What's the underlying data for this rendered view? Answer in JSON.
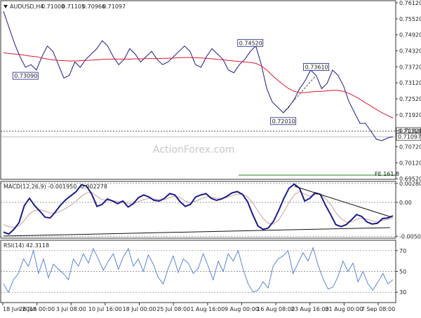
{
  "chart_data": [
    {
      "type": "line",
      "panel": "price",
      "symbol_label": "AUDUSD,H4",
      "ohlc": [
        "0.71000",
        "0.71105",
        "0.70966",
        "0.71097"
      ],
      "ylim": [
        0.695,
        0.762
      ],
      "yticks": [
        "0.76120",
        "0.75520",
        "0.74920",
        "0.74320",
        "0.73720",
        "0.73120",
        "0.72520",
        "0.71920",
        "0.71320",
        "0.70720",
        "0.70120",
        "0.69520"
      ],
      "series": [
        {
          "values": [
            0.758,
            0.752,
            0.746,
            0.741,
            0.737,
            0.738,
            0.736,
            0.741,
            0.745,
            0.743,
            0.738,
            0.733,
            0.734,
            0.739,
            0.737,
            0.74,
            0.742,
            0.744,
            0.747,
            0.745,
            0.741,
            0.738,
            0.74,
            0.744,
            0.742,
            0.739,
            0.741,
            0.743,
            0.74,
            0.738,
            0.739,
            0.741,
            0.743,
            0.745,
            0.743,
            0.738,
            0.737,
            0.741,
            0.744,
            0.742,
            0.74,
            0.736,
            0.735,
            0.738,
            0.74,
            0.743,
            0.745,
            0.738,
            0.729,
            0.724,
            0.722,
            0.72,
            0.722,
            0.725,
            0.729,
            0.732,
            0.736,
            0.734,
            0.729,
            0.731,
            0.736,
            0.734,
            0.73,
            0.724,
            0.72,
            0.716,
            0.716,
            0.713,
            0.71,
            0.7095,
            0.7105,
            0.71097
          ]
        },
        {
          "values": [
            0.7425,
            0.7422,
            0.742,
            0.7418,
            0.7415,
            0.7412,
            0.741,
            0.7405,
            0.7401,
            0.7398,
            0.7396,
            0.7395,
            0.7394,
            0.7394,
            0.7395,
            0.7396,
            0.7397,
            0.7398,
            0.74,
            0.7401,
            0.7401,
            0.7401,
            0.7401,
            0.7401,
            0.7402,
            0.7402,
            0.7403,
            0.7403,
            0.7403,
            0.7404,
            0.7404,
            0.7405,
            0.7406,
            0.7407,
            0.7407,
            0.7406,
            0.7405,
            0.7404,
            0.7402,
            0.74,
            0.7398,
            0.7396,
            0.7394,
            0.7392,
            0.739,
            0.7388,
            0.7385,
            0.7375,
            0.736,
            0.734,
            0.7322,
            0.7305,
            0.729,
            0.728,
            0.7275,
            0.7275,
            0.7278,
            0.728,
            0.728,
            0.7282,
            0.7284,
            0.7283,
            0.728,
            0.7272,
            0.7262,
            0.725,
            0.7237,
            0.7225,
            0.7212,
            0.72,
            0.719,
            0.718
          ]
        }
      ],
      "current_price": "0.71097",
      "horizontal_line": "0.71310",
      "price_labels": [
        "0.74520",
        "0.73090",
        "0.73610",
        "0.72010"
      ],
      "annotation": "FE 161.8",
      "watermark": "ActionForex.com"
    },
    {
      "type": "line",
      "panel": "macd",
      "label": "MACD(12,26,9) -0.001950 -0.002278",
      "ylim": [
        -0.0053,
        0.0031
      ],
      "yticks": [
        "0.002804",
        "0.00",
        "-0.005019"
      ],
      "series": [
        {
          "values": [
            -0.0044,
            -0.0047,
            -0.004,
            -0.003,
            -0.0005,
            0.0006,
            -0.0005,
            -0.0013,
            -0.0022,
            -0.0023,
            -0.0014,
            -0.0004,
            0.0004,
            0.001,
            0.0016,
            0.0026,
            0.0024,
            0.0012,
            -0.0006,
            -0.0003,
            0.0005,
            0.0002,
            -0.0002,
            0.0002,
            -0.0007,
            -0.0002,
            0.0007,
            0.0011,
            0.0008,
            0.0003,
            0.0002,
            0.0006,
            0.0013,
            0.0011,
            0.0001,
            -0.0006,
            -0.0003,
            0.0008,
            0.0011,
            0.0013,
            0.0006,
            0.0003,
            0.0005,
            0.0009,
            0.0014,
            0.0016,
            0.0012,
            0.0001,
            -0.0018,
            -0.0035,
            -0.004,
            -0.0038,
            -0.0028,
            -0.0012,
            0.0006,
            0.0021,
            0.0027,
            0.0021,
            0.0002,
            0.0006,
            0.0014,
            0.0012,
            -0.0004,
            -0.0018,
            -0.0033,
            -0.0036,
            -0.0033,
            -0.0026,
            -0.0018,
            -0.0021,
            -0.0029,
            -0.0032,
            -0.0031,
            -0.0024,
            -0.0023,
            -0.002
          ]
        },
        {
          "values": [
            -0.0033,
            -0.0036,
            -0.0037,
            -0.0035,
            -0.0027,
            -0.0017,
            -0.0012,
            -0.0011,
            -0.0013,
            -0.0016,
            -0.0016,
            -0.0013,
            -0.0009,
            -0.0004,
            0.0002,
            0.0009,
            0.0014,
            0.0015,
            0.0009,
            0.0004,
            0.0003,
            0.0003,
            0.0001,
            0.0001,
            -0.0002,
            -0.0002,
            0.0001,
            0.0004,
            0.0006,
            0.0005,
            0.0004,
            0.0004,
            0.0007,
            0.0009,
            0.0007,
            0.0002,
            -0.0001,
            0.0002,
            0.0005,
            0.0008,
            0.0008,
            0.0006,
            0.0006,
            0.0007,
            0.001,
            0.0012,
            0.0012,
            0.0008,
            -0.0001,
            -0.0013,
            -0.0024,
            -0.0031,
            -0.0032,
            -0.0026,
            -0.0014,
            0.0,
            0.0011,
            0.0016,
            0.0012,
            0.0009,
            0.0011,
            0.0012,
            0.0006,
            -0.0003,
            -0.0015,
            -0.0024,
            -0.0029,
            -0.0029,
            -0.0025,
            -0.0023,
            -0.0025,
            -0.0027,
            -0.0029,
            -0.0027,
            -0.0025,
            -0.0023
          ]
        }
      ]
    },
    {
      "type": "line",
      "panel": "rsi",
      "label": "RSI(14) 42.3118",
      "ylim": [
        20,
        80
      ],
      "yticks": [
        "70",
        "50",
        "30"
      ],
      "series": [
        {
          "values": [
            38,
            30,
            42,
            48,
            62,
            55,
            70,
            48,
            62,
            44,
            57,
            52,
            48,
            42,
            62,
            55,
            67,
            58,
            72,
            62,
            51,
            60,
            67,
            52,
            64,
            72,
            55,
            62,
            50,
            66,
            57,
            44,
            38,
            53,
            65,
            49,
            62,
            58,
            48,
            53,
            67,
            55,
            42,
            60,
            50,
            67,
            60,
            70,
            52,
            38,
            30,
            32,
            40,
            34,
            55,
            62,
            65,
            70,
            48,
            58,
            68,
            60,
            73,
            56,
            43,
            33,
            35,
            45,
            60,
            50,
            58,
            40,
            50,
            38,
            32,
            40,
            48,
            38,
            42
          ]
        }
      ],
      "xticks": [
        "18 Jun 2018",
        "26 Jun 00:00",
        "3 Jul 08:00",
        "10 Jul 16:00",
        "18 Jul 00:00",
        "25 Jul 08:00",
        "1 Aug 16:00",
        "9 Aug 00:00",
        "16 Aug 08:00",
        "23 Aug 16:00",
        "31 Aug 00:00",
        "7 Sep 08:00"
      ]
    }
  ]
}
